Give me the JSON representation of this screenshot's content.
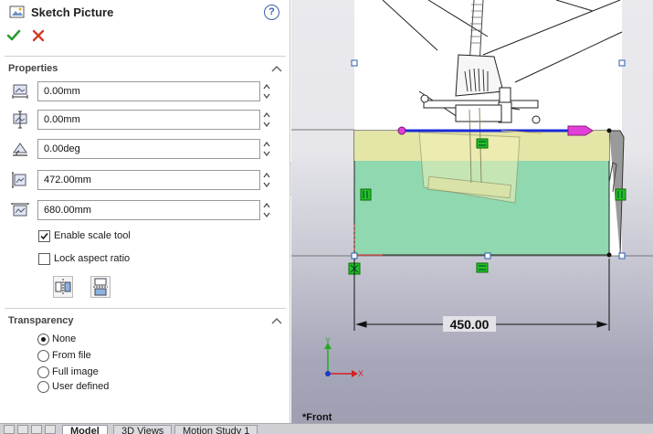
{
  "panel": {
    "title": "Sketch Picture",
    "help_glyph": "?",
    "ok_icon": "check-icon",
    "cancel_icon": "close-icon"
  },
  "properties": {
    "header": "Properties",
    "fields": [
      {
        "icon": "x-origin-icon",
        "value": "0.00mm"
      },
      {
        "icon": "y-origin-icon",
        "value": "0.00mm"
      },
      {
        "icon": "rotation-angle-icon",
        "value": "0.00deg"
      },
      {
        "icon": "height-icon",
        "value": "472.00mm"
      },
      {
        "icon": "width-icon",
        "value": "680.00mm"
      }
    ],
    "enable_scale_tool": {
      "label": "Enable scale tool",
      "checked": true
    },
    "lock_aspect_ratio": {
      "label": "Lock aspect ratio",
      "checked": false
    },
    "tool_buttons": [
      "flip-horizontal-icon",
      "flip-vertical-icon"
    ]
  },
  "transparency": {
    "header": "Transparency",
    "selected": "None",
    "options": [
      "None",
      "From file",
      "Full image",
      "User defined"
    ]
  },
  "viewport": {
    "dimension_value": "450.00",
    "view_name": "*Front",
    "triad_x": "X",
    "triad_y": "Y"
  },
  "tabs": [
    {
      "label": "Model",
      "active": true
    },
    {
      "label": "3D Views",
      "active": false
    },
    {
      "label": "Motion Study 1",
      "active": false
    }
  ],
  "colors": {
    "accept_green": "#2e9a2e",
    "cancel_red": "#d43a2a",
    "sketch_blue": "#1a2ad8",
    "water_green": "#8fd8b0",
    "water_yellow": "#e9e7a6",
    "magenta": "#e23fd9"
  }
}
